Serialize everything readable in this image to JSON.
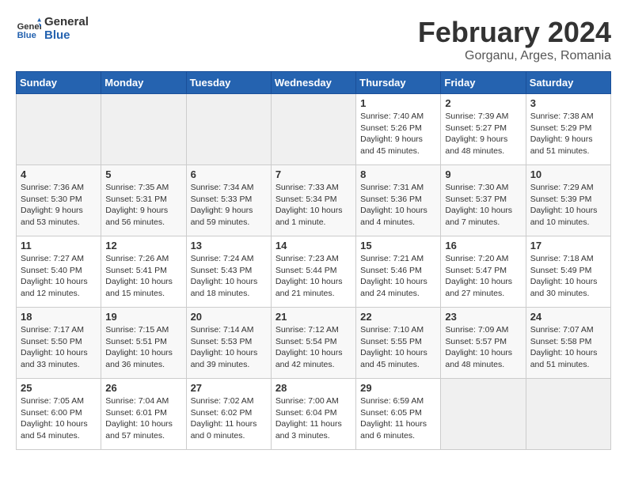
{
  "header": {
    "logo_line1": "General",
    "logo_line2": "Blue",
    "title": "February 2024",
    "subtitle": "Gorganu, Arges, Romania"
  },
  "days_of_week": [
    "Sunday",
    "Monday",
    "Tuesday",
    "Wednesday",
    "Thursday",
    "Friday",
    "Saturday"
  ],
  "weeks": [
    [
      {
        "day": "",
        "info": ""
      },
      {
        "day": "",
        "info": ""
      },
      {
        "day": "",
        "info": ""
      },
      {
        "day": "",
        "info": ""
      },
      {
        "day": "1",
        "info": "Sunrise: 7:40 AM\nSunset: 5:26 PM\nDaylight: 9 hours\nand 45 minutes."
      },
      {
        "day": "2",
        "info": "Sunrise: 7:39 AM\nSunset: 5:27 PM\nDaylight: 9 hours\nand 48 minutes."
      },
      {
        "day": "3",
        "info": "Sunrise: 7:38 AM\nSunset: 5:29 PM\nDaylight: 9 hours\nand 51 minutes."
      }
    ],
    [
      {
        "day": "4",
        "info": "Sunrise: 7:36 AM\nSunset: 5:30 PM\nDaylight: 9 hours\nand 53 minutes."
      },
      {
        "day": "5",
        "info": "Sunrise: 7:35 AM\nSunset: 5:31 PM\nDaylight: 9 hours\nand 56 minutes."
      },
      {
        "day": "6",
        "info": "Sunrise: 7:34 AM\nSunset: 5:33 PM\nDaylight: 9 hours\nand 59 minutes."
      },
      {
        "day": "7",
        "info": "Sunrise: 7:33 AM\nSunset: 5:34 PM\nDaylight: 10 hours\nand 1 minute."
      },
      {
        "day": "8",
        "info": "Sunrise: 7:31 AM\nSunset: 5:36 PM\nDaylight: 10 hours\nand 4 minutes."
      },
      {
        "day": "9",
        "info": "Sunrise: 7:30 AM\nSunset: 5:37 PM\nDaylight: 10 hours\nand 7 minutes."
      },
      {
        "day": "10",
        "info": "Sunrise: 7:29 AM\nSunset: 5:39 PM\nDaylight: 10 hours\nand 10 minutes."
      }
    ],
    [
      {
        "day": "11",
        "info": "Sunrise: 7:27 AM\nSunset: 5:40 PM\nDaylight: 10 hours\nand 12 minutes."
      },
      {
        "day": "12",
        "info": "Sunrise: 7:26 AM\nSunset: 5:41 PM\nDaylight: 10 hours\nand 15 minutes."
      },
      {
        "day": "13",
        "info": "Sunrise: 7:24 AM\nSunset: 5:43 PM\nDaylight: 10 hours\nand 18 minutes."
      },
      {
        "day": "14",
        "info": "Sunrise: 7:23 AM\nSunset: 5:44 PM\nDaylight: 10 hours\nand 21 minutes."
      },
      {
        "day": "15",
        "info": "Sunrise: 7:21 AM\nSunset: 5:46 PM\nDaylight: 10 hours\nand 24 minutes."
      },
      {
        "day": "16",
        "info": "Sunrise: 7:20 AM\nSunset: 5:47 PM\nDaylight: 10 hours\nand 27 minutes."
      },
      {
        "day": "17",
        "info": "Sunrise: 7:18 AM\nSunset: 5:49 PM\nDaylight: 10 hours\nand 30 minutes."
      }
    ],
    [
      {
        "day": "18",
        "info": "Sunrise: 7:17 AM\nSunset: 5:50 PM\nDaylight: 10 hours\nand 33 minutes."
      },
      {
        "day": "19",
        "info": "Sunrise: 7:15 AM\nSunset: 5:51 PM\nDaylight: 10 hours\nand 36 minutes."
      },
      {
        "day": "20",
        "info": "Sunrise: 7:14 AM\nSunset: 5:53 PM\nDaylight: 10 hours\nand 39 minutes."
      },
      {
        "day": "21",
        "info": "Sunrise: 7:12 AM\nSunset: 5:54 PM\nDaylight: 10 hours\nand 42 minutes."
      },
      {
        "day": "22",
        "info": "Sunrise: 7:10 AM\nSunset: 5:55 PM\nDaylight: 10 hours\nand 45 minutes."
      },
      {
        "day": "23",
        "info": "Sunrise: 7:09 AM\nSunset: 5:57 PM\nDaylight: 10 hours\nand 48 minutes."
      },
      {
        "day": "24",
        "info": "Sunrise: 7:07 AM\nSunset: 5:58 PM\nDaylight: 10 hours\nand 51 minutes."
      }
    ],
    [
      {
        "day": "25",
        "info": "Sunrise: 7:05 AM\nSunset: 6:00 PM\nDaylight: 10 hours\nand 54 minutes."
      },
      {
        "day": "26",
        "info": "Sunrise: 7:04 AM\nSunset: 6:01 PM\nDaylight: 10 hours\nand 57 minutes."
      },
      {
        "day": "27",
        "info": "Sunrise: 7:02 AM\nSunset: 6:02 PM\nDaylight: 11 hours\nand 0 minutes."
      },
      {
        "day": "28",
        "info": "Sunrise: 7:00 AM\nSunset: 6:04 PM\nDaylight: 11 hours\nand 3 minutes."
      },
      {
        "day": "29",
        "info": "Sunrise: 6:59 AM\nSunset: 6:05 PM\nDaylight: 11 hours\nand 6 minutes."
      },
      {
        "day": "",
        "info": ""
      },
      {
        "day": "",
        "info": ""
      }
    ]
  ]
}
